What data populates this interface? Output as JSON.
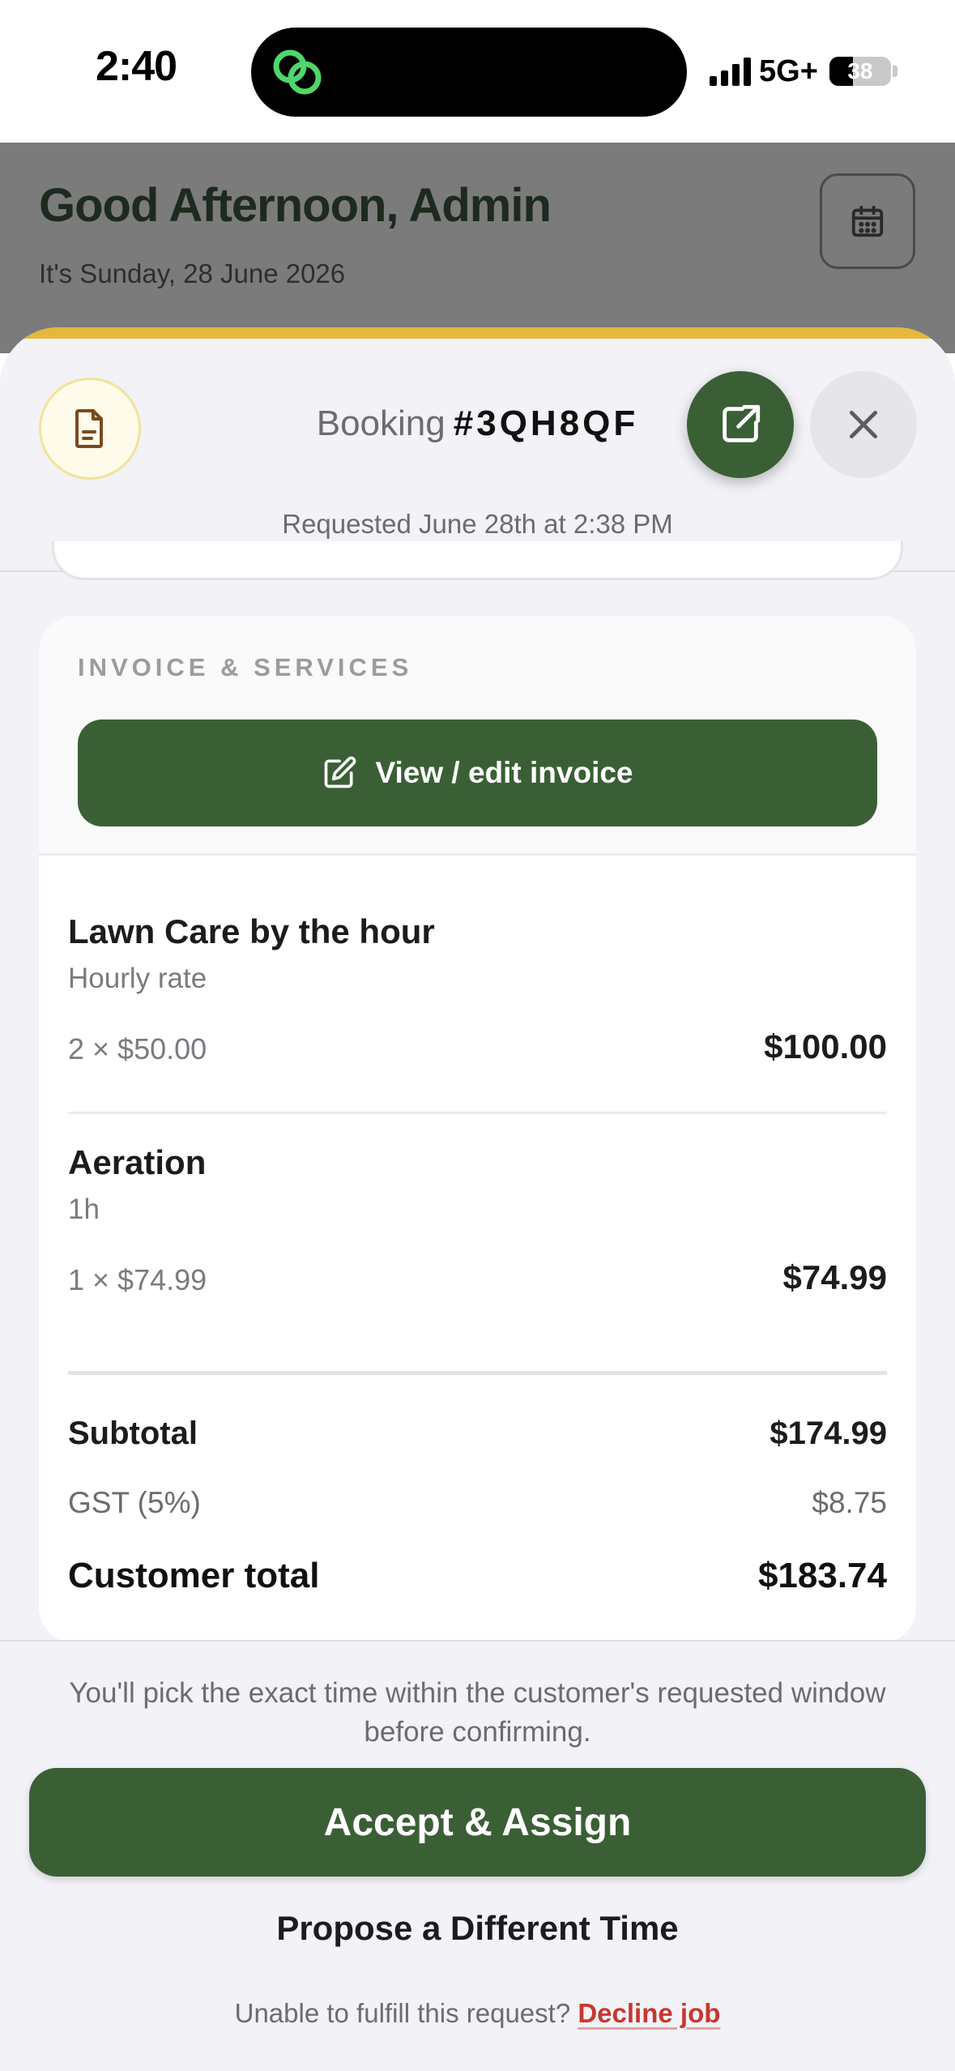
{
  "status_bar": {
    "time": "2:40",
    "network": "5G+",
    "battery": "38",
    "battery_level": 0.38
  },
  "background": {
    "greeting": "Good Afternoon, Admin",
    "date": "It's Sunday, 28 June 2026"
  },
  "sheet": {
    "booking_label": "Booking",
    "booking_id": "#3QH8QF",
    "requested": "Requested June 28th at 2:38 PM",
    "accent_color": "#e6b73a"
  },
  "invoice": {
    "section_label": "INVOICE & SERVICES",
    "edit_button": "View / edit invoice",
    "items": [
      {
        "name": "Lawn Care by the hour",
        "description": "Hourly rate",
        "qty": "2 × $50.00",
        "amount": "$100.00"
      },
      {
        "name": "Aeration",
        "description": "1h",
        "qty": "1 × $74.99",
        "amount": "$74.99"
      }
    ],
    "subtotal_label": "Subtotal",
    "subtotal_value": "$174.99",
    "tax_label": "GST (5%)",
    "tax_value": "$8.75",
    "total_label": "Customer total",
    "total_value": "$183.74"
  },
  "actions": {
    "hint": "You'll pick the exact time within the customer's requested window before confirming.",
    "accept": "Accept & Assign",
    "propose": "Propose a Different Time",
    "decline_prompt": "Unable to fulfill this request?",
    "decline_link": "Decline job"
  },
  "colors": {
    "brand_green": "#3a5f35",
    "decline_red": "#c8372d"
  }
}
